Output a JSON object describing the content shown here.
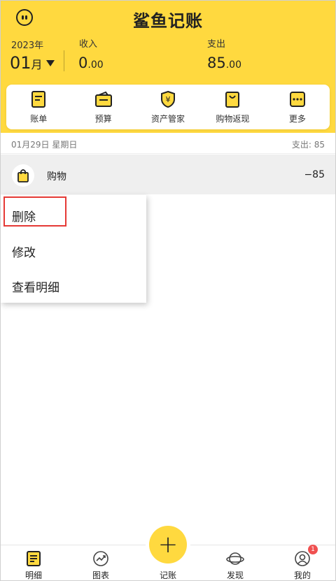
{
  "header": {
    "app_title": "鲨鱼记账",
    "year": "2023年",
    "month": "01",
    "month_suffix": "月",
    "income_label": "收入",
    "income_int": "0",
    "income_dec": ".00",
    "expense_label": "支出",
    "expense_int": "85",
    "expense_dec": ".00",
    "accent_color": "#FFD93F"
  },
  "quick_menu": [
    {
      "label": "账单",
      "icon": "bill-icon"
    },
    {
      "label": "预算",
      "icon": "budget-wallet-icon"
    },
    {
      "label": "资产管家",
      "icon": "asset-shield-yen-icon"
    },
    {
      "label": "购物返现",
      "icon": "shopping-bag-icon"
    },
    {
      "label": "更多",
      "icon": "more-icon"
    }
  ],
  "day": {
    "date": "01月29日 星期日",
    "expense": "支出: 85"
  },
  "transaction": {
    "category": "购物",
    "amount": "−85",
    "icon": "shopping-bag-icon"
  },
  "context_menu": {
    "delete": "删除",
    "edit": "修改",
    "detail": "查看明细"
  },
  "bottom_nav": [
    {
      "label": "明细",
      "icon": "detail-list-icon"
    },
    {
      "label": "图表",
      "icon": "chart-trend-icon"
    },
    {
      "label": "记账",
      "icon": "plus-icon"
    },
    {
      "label": "发现",
      "icon": "planet-icon"
    },
    {
      "label": "我的",
      "icon": "profile-icon",
      "badge": "1"
    }
  ]
}
